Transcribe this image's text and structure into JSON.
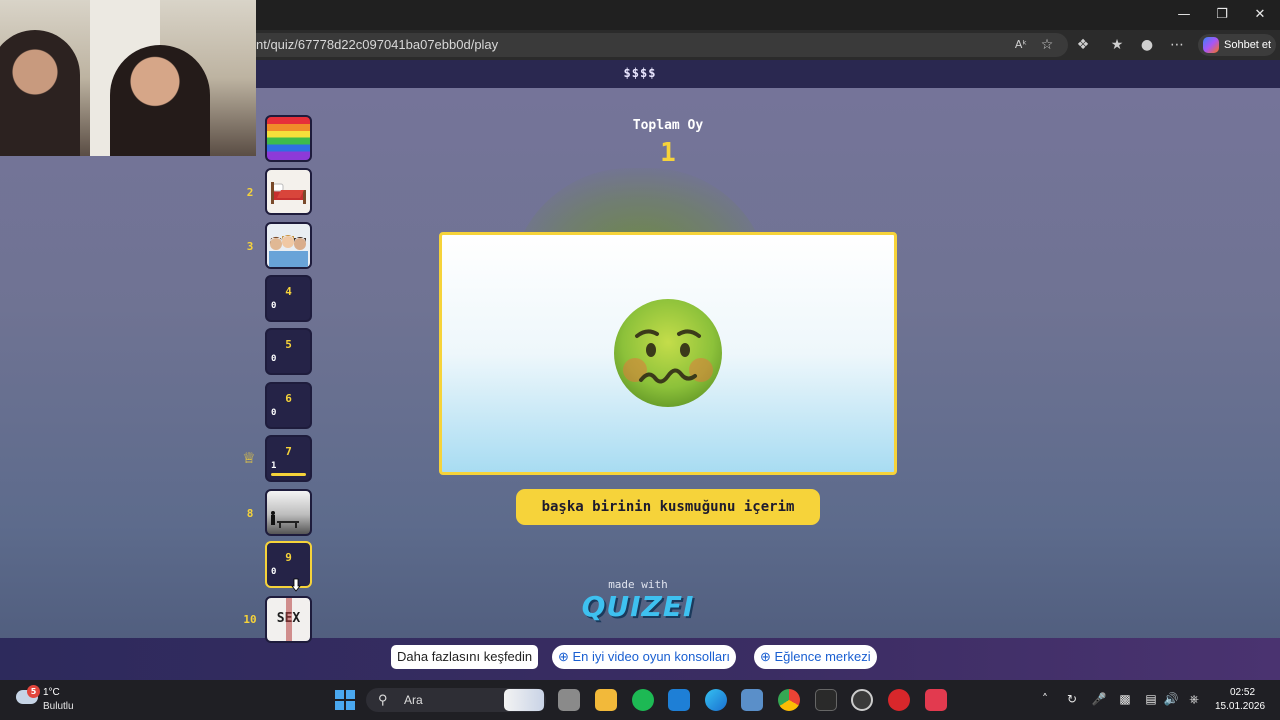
{
  "browser": {
    "url": "nt/quiz/67778d22c097041ba07ebb0d/play",
    "copilot_label": "Sohbet et"
  },
  "page": {
    "header_text": "$$$$",
    "total_label": "Toplam Oy",
    "total_value": "1",
    "question_text": "başka birinin kusmuğunu içerim",
    "made_with": "made with",
    "brand": "QUIZEI"
  },
  "sidebar": {
    "items": [
      {
        "num": "",
        "type": "image",
        "image": "rainbow-flag"
      },
      {
        "num": "2",
        "type": "image",
        "image": "bed"
      },
      {
        "num": "3",
        "type": "image",
        "image": "people"
      },
      {
        "num": "4",
        "type": "text",
        "count": "0"
      },
      {
        "num": "5",
        "type": "text",
        "count": "0"
      },
      {
        "num": "6",
        "type": "text",
        "count": "0"
      },
      {
        "num": "7",
        "type": "text",
        "count": "1",
        "winner": true
      },
      {
        "num": "8",
        "type": "image",
        "image": "person-on-bench"
      },
      {
        "num": "9",
        "type": "text",
        "count": "0",
        "active": true
      },
      {
        "num": "10",
        "type": "image",
        "image": "sex-sign",
        "image_text": "SEX"
      }
    ]
  },
  "footer_chips": [
    {
      "label": "Daha fazlasını keşfedin",
      "kind": "plain"
    },
    {
      "label": "⊕ En iyi video oyun konsolları",
      "kind": "link"
    },
    {
      "label": "⊕ Eğlence merkezi",
      "kind": "link"
    }
  ],
  "taskbar": {
    "weather_badge": "5",
    "weather_temp": "1°C",
    "weather_desc": "Bulutlu",
    "search_placeholder": "Ara",
    "time": "02:52",
    "date": "15.01.2026"
  },
  "colors": {
    "accent": "#f6d33a",
    "page_bg": "#6f7393",
    "header_bg": "#2a2850",
    "slot_bg": "#252347",
    "link": "#1a5fd1"
  },
  "icons": {
    "emoji": "nauseated-face",
    "winner": "crown-icon"
  }
}
